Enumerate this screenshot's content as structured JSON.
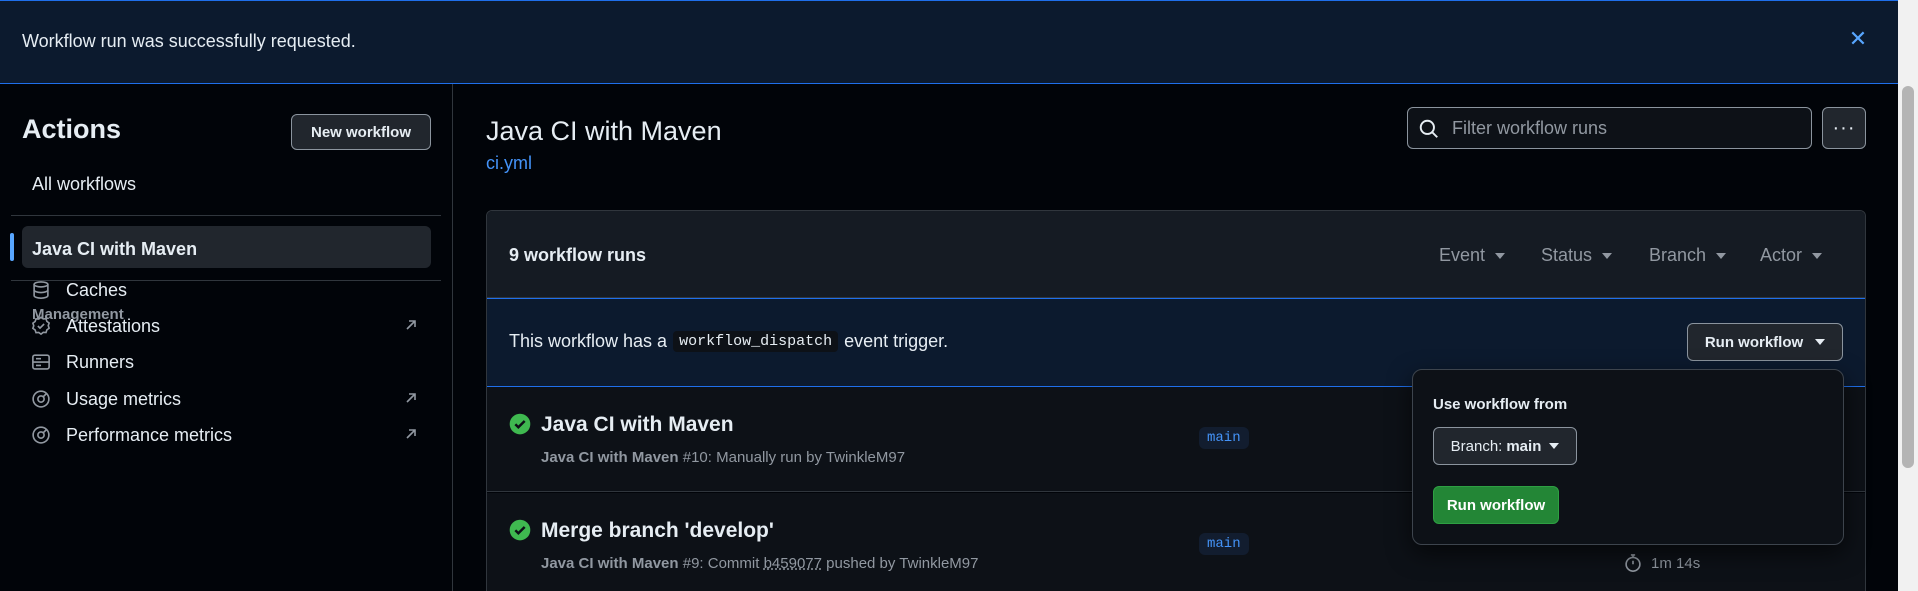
{
  "flash": {
    "message": "Workflow run was successfully requested.",
    "close_icon": "close-icon"
  },
  "sidebar": {
    "title": "Actions",
    "new_workflow_label": "New workflow",
    "all_workflows_label": "All workflows",
    "active_workflow_label": "Java CI with Maven",
    "management_heading": "Management",
    "items": [
      {
        "label": "Caches",
        "icon": "database-icon",
        "external": false
      },
      {
        "label": "Attestations",
        "icon": "verified-icon",
        "external": true
      },
      {
        "label": "Runners",
        "icon": "server-icon",
        "external": false
      },
      {
        "label": "Usage metrics",
        "icon": "meter-icon",
        "external": true
      },
      {
        "label": "Performance metrics",
        "icon": "meter-icon",
        "external": true
      }
    ]
  },
  "main": {
    "title": "Java CI with Maven",
    "file_link": "ci.yml",
    "search_placeholder": "Filter workflow runs",
    "more_label": "···",
    "runs_count": "9 workflow runs",
    "filters": [
      "Event",
      "Status",
      "Branch",
      "Actor"
    ],
    "dispatch": {
      "text_before": "This workflow has a",
      "code": "workflow_dispatch",
      "text_after": "event trigger.",
      "run_button": "Run workflow"
    },
    "runs": [
      {
        "title": "Java CI with Maven",
        "workflow": "Java CI with Maven",
        "number": "#10",
        "detail_prefix": ": Manually run by TwinkleM97",
        "sha": "",
        "detail_suffix": "",
        "branch": "main",
        "duration": ""
      },
      {
        "title": "Merge branch 'develop'",
        "workflow": "Java CI with Maven",
        "number": "#9",
        "detail_prefix": ": Commit ",
        "sha": "b459077",
        "detail_suffix": " pushed by TwinkleM97",
        "branch": "main",
        "duration": "1m 14s"
      }
    ]
  },
  "popover": {
    "title": "Use workflow from",
    "branch_prefix": "Branch:",
    "branch_value": "main",
    "run_button": "Run workflow"
  },
  "colors": {
    "accent": "#4493f8",
    "success": "#238636",
    "background": "#010409"
  }
}
